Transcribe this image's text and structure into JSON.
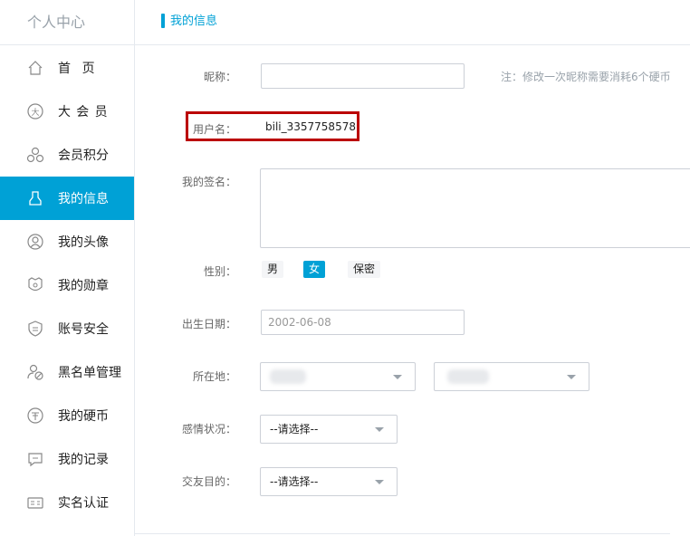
{
  "sidebar": {
    "title": "个人中心",
    "items": [
      {
        "label": "首页",
        "icon": "home-icon"
      },
      {
        "label": "大会员",
        "icon": "vip-icon"
      },
      {
        "label": "会员积分",
        "icon": "points-icon"
      },
      {
        "label": "我的信息",
        "icon": "user-icon",
        "active": true
      },
      {
        "label": "我的头像",
        "icon": "avatar-icon"
      },
      {
        "label": "我的勋章",
        "icon": "medal-icon"
      },
      {
        "label": "账号安全",
        "icon": "shield-icon"
      },
      {
        "label": "黑名单管理",
        "icon": "blacklist-icon"
      },
      {
        "label": "我的硬币",
        "icon": "coin-icon"
      },
      {
        "label": "我的记录",
        "icon": "record-icon"
      },
      {
        "label": "实名认证",
        "icon": "id-card-icon"
      }
    ]
  },
  "header": {
    "title": "我的信息"
  },
  "form": {
    "nickname": {
      "label": "昵称：",
      "value": "",
      "hint": "注：修改一次昵称需要消耗6个硬币"
    },
    "username": {
      "label": "用户名：",
      "value": "bili_3357758578"
    },
    "signature": {
      "label": "我的签名：",
      "value": ""
    },
    "gender": {
      "label": "性别：",
      "options": [
        "男",
        "女",
        "保密"
      ],
      "selected": "女"
    },
    "birthday": {
      "label": "出生日期：",
      "value": "2002-06-08"
    },
    "location": {
      "label": "所在地："
    },
    "relationship": {
      "label": "感情状况：",
      "value": "--请选择--"
    },
    "purpose": {
      "label": "交友目的：",
      "value": "--请选择--"
    }
  },
  "colors": {
    "accent": "#00a1d6",
    "highlight_border": "#b00000"
  }
}
